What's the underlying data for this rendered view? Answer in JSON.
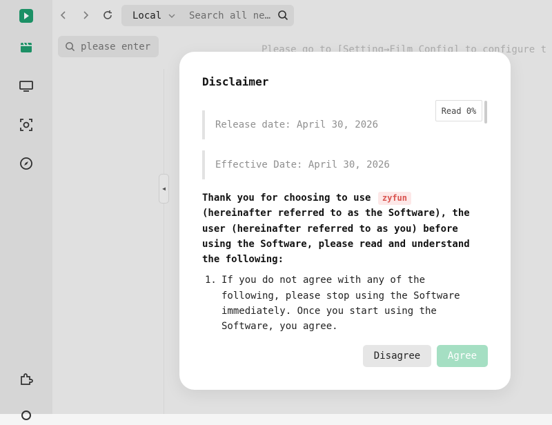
{
  "topbar": {
    "source_label": "Local",
    "search_placeholder": "Search all ne…"
  },
  "left_panel": {
    "search_placeholder": "please enter"
  },
  "main": {
    "hint": "Please go to [Setting→Film Config] to configure t"
  },
  "colors": {
    "brand": "#1f9d6e",
    "agree_button": "#a5dfc3",
    "tag_bg": "#fde8e8",
    "tag_text": "#d9534f"
  },
  "icons": {
    "logo": "play-logo-icon",
    "sidebar": [
      "film-icon",
      "tv-icon",
      "scan-icon",
      "compass-icon",
      "puzzle-icon",
      "settings-icon"
    ],
    "topbar": [
      "chevron-left-icon",
      "chevron-right-icon",
      "refresh-icon",
      "chevron-down-icon",
      "search-icon"
    ]
  },
  "modal": {
    "title": "Disclaimer",
    "read_progress": "Read 0%",
    "release_date": "Release date: April 30, 2026",
    "effective_date": "Effective Date: April 30, 2026",
    "intro_before": "Thank you for choosing to use",
    "app_name": "zyfun",
    "intro_after": "(hereinafter referred to as the Software), the user (hereinafter referred to as you) before using the Software, please read and understand the following:",
    "items": [
      {
        "num": "1.",
        "text": "If you do not agree with any of the following, please stop using the Software immediately. Once you start using the Software, you agree."
      }
    ],
    "disagree_label": "Disagree",
    "agree_label": "Agree"
  }
}
